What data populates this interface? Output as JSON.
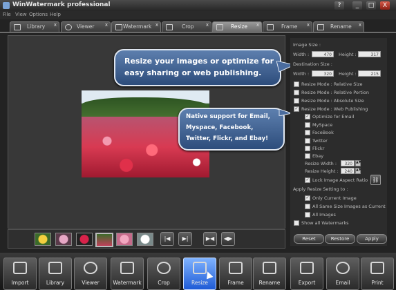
{
  "window": {
    "title": "WinWatermark professional",
    "controls": [
      "?",
      "_",
      "□",
      "X"
    ]
  },
  "menu": {
    "items": [
      "File",
      "View",
      "Options",
      "Help"
    ]
  },
  "tabs": [
    {
      "label": "Library",
      "icon": "library-icon",
      "active": false
    },
    {
      "label": "Viewer",
      "icon": "magnifier-icon",
      "active": false
    },
    {
      "label": "Watermark",
      "icon": "lock-icon",
      "active": false
    },
    {
      "label": "Crop",
      "icon": "crop-icon",
      "active": false
    },
    {
      "label": "Resize",
      "icon": "resize-icon",
      "active": true
    },
    {
      "label": "Frame",
      "icon": "frame-icon",
      "active": false
    },
    {
      "label": "Rename",
      "icon": "pencil-icon",
      "active": false
    }
  ],
  "callouts": {
    "main": [
      "Resize your images or optimize for",
      "easy sharing or web publishing."
    ],
    "email": [
      "Native support for Email,",
      "Myspace, Facebook,",
      "Twitter, Flickr, and Ebay!"
    ]
  },
  "filmstrip": {
    "thumbs": 6,
    "selected": 3,
    "nav": [
      "|◀",
      "▶|",
      "▶◀",
      "◀▶"
    ]
  },
  "panel": {
    "image_size_label": "Image Size :",
    "width_label": "Width :",
    "height_label": "Height :",
    "image_width": "470",
    "image_height": "317",
    "dest_size_label": "Destination Size :",
    "dest_width": "320",
    "dest_height": "215",
    "modes": [
      {
        "label": "Resize Mode : Relative Size",
        "checked": false
      },
      {
        "label": "Resize Mode : Relative Portion",
        "checked": false
      },
      {
        "label": "Resize Mode : Absolute Size",
        "checked": false
      },
      {
        "label": "Resize Mode : Web Publishing",
        "checked": true
      }
    ],
    "web": [
      {
        "label": "Optimize for Email",
        "checked": true
      },
      {
        "label": "MySpace",
        "checked": false
      },
      {
        "label": "FaceBook",
        "checked": false
      },
      {
        "label": "Twitter",
        "checked": false
      },
      {
        "label": "Flickr",
        "checked": false
      },
      {
        "label": "Ebay",
        "checked": false
      }
    ],
    "resize_width_label": "Resize Width :",
    "resize_width": "320",
    "resize_height_label": "Resize Height :",
    "resize_height": "240",
    "lock_ratio": {
      "label": "Lock Image Aspect Ratio",
      "checked": true
    },
    "apply_label": "Apply Resize Setting to :",
    "apply_opts": [
      {
        "label": "Only Current Image",
        "checked": true
      },
      {
        "label": "All Same Size Images as Current",
        "checked": false
      },
      {
        "label": "All Images",
        "checked": false
      }
    ],
    "show_watermarks": {
      "label": "Show all Watermarks",
      "checked": false
    },
    "buttons": {
      "reset": "Reset",
      "restore": "Restore",
      "apply": "Apply"
    }
  },
  "toolbar": [
    {
      "label": "Import",
      "icon": "camera-icon"
    },
    {
      "label": "Library",
      "icon": "library-icon"
    },
    {
      "label": "Viewer",
      "icon": "magnifier-icon"
    },
    {
      "label": "Watermark",
      "icon": "lock-icon"
    },
    {
      "label": "Crop",
      "icon": "scissors-icon"
    },
    {
      "label": "Resize",
      "icon": "resize-icon",
      "active": true
    },
    {
      "label": "Frame",
      "icon": "frame-icon"
    },
    {
      "label": "Rename",
      "icon": "pencil-icon"
    },
    {
      "label": "Export",
      "icon": "export-icon"
    },
    {
      "label": "Email",
      "icon": "envelope-icon"
    },
    {
      "label": "Print",
      "icon": "printer-icon"
    }
  ],
  "colors": {
    "accent": "#1f5bd6",
    "callout": "#3d5f92",
    "background": "#232323"
  }
}
